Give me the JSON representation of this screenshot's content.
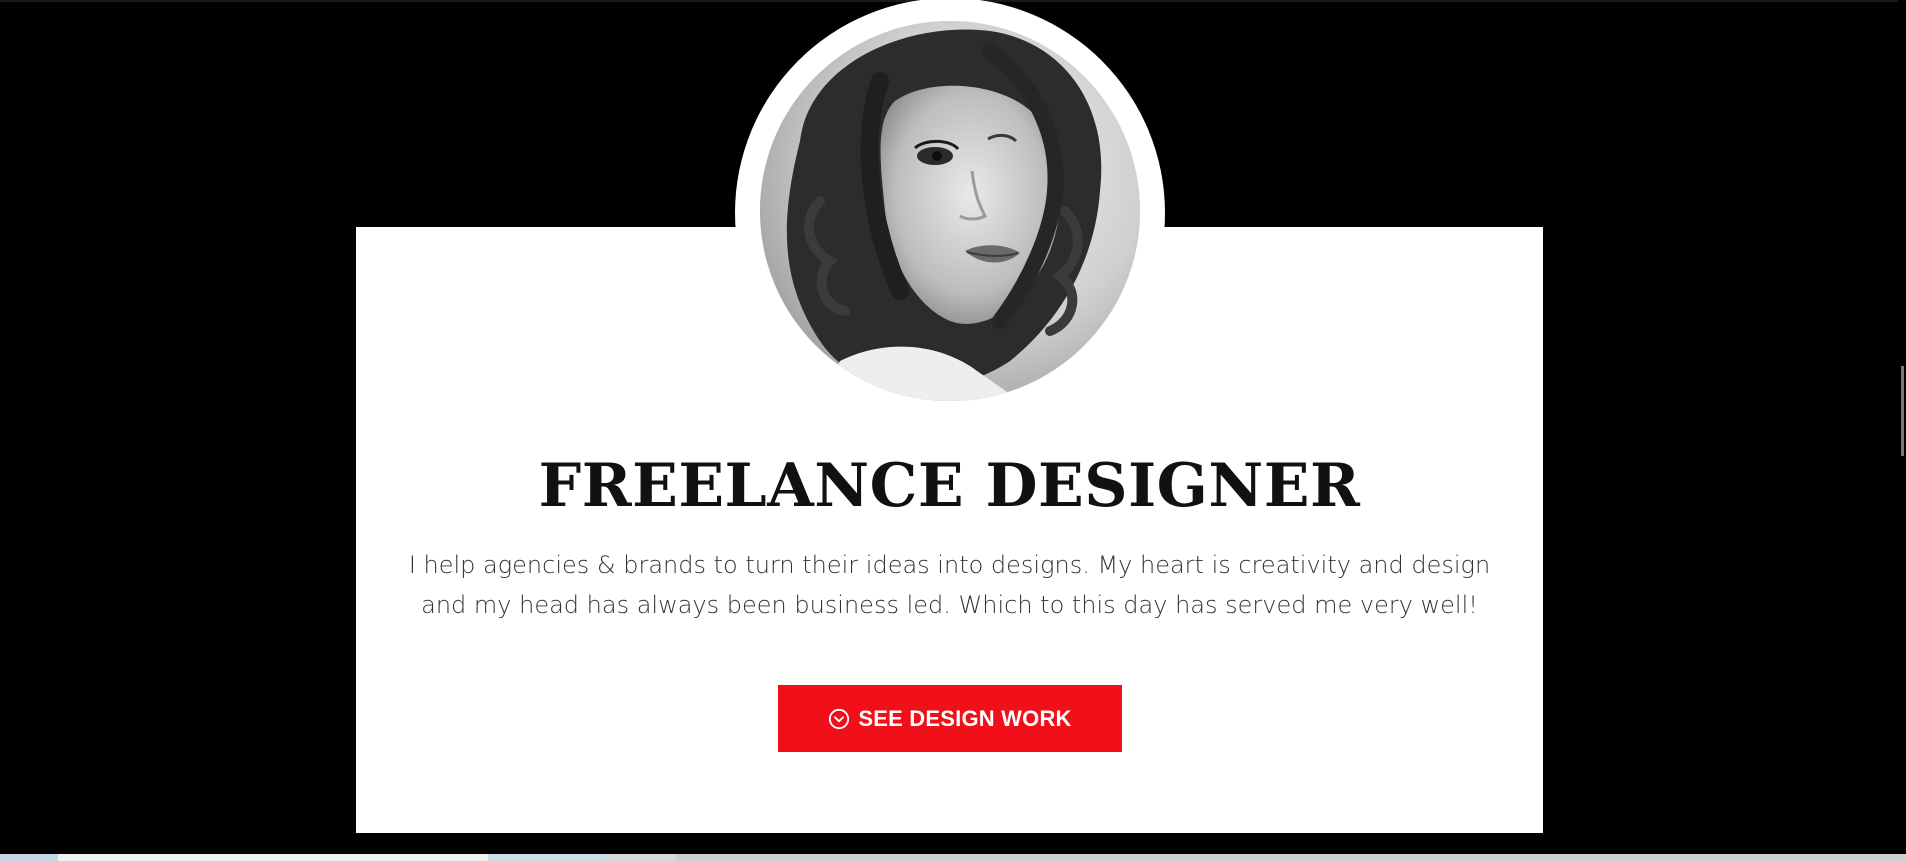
{
  "hero": {
    "avatar_alt": "Portrait of a woman with curly hair",
    "title": "FREELANCE DESIGNER",
    "description": "I help agencies & brands to turn their ideas into designs. My heart is creativity and design and my head has always been business led. Which to this day has served me very well!",
    "cta": {
      "label": "SEE DESIGN WORK",
      "icon": "chevron-circle-down-icon",
      "color": "#f10f1a"
    }
  },
  "colors": {
    "background": "#000000",
    "card": "#ffffff",
    "text": "#111111",
    "accent": "#f10f1a"
  }
}
